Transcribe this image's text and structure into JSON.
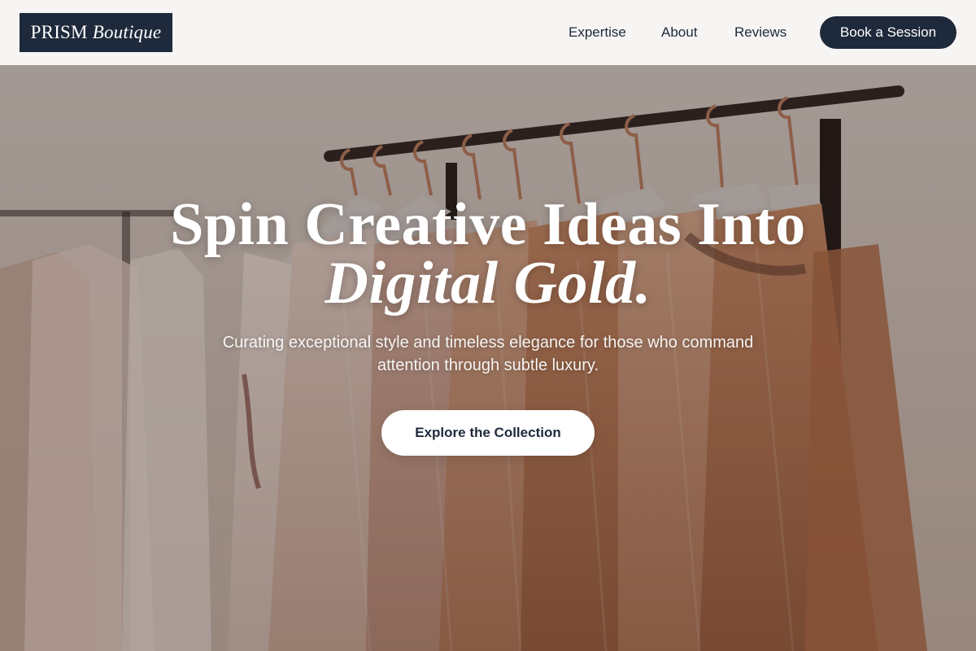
{
  "header": {
    "logo": {
      "main": "PRISM",
      "italic": "Boutique"
    },
    "nav": [
      {
        "label": "Expertise"
      },
      {
        "label": "About"
      },
      {
        "label": "Reviews"
      }
    ],
    "cta_label": "Book a Session"
  },
  "hero": {
    "title_line1": "Spin Creative Ideas Into",
    "title_line2": "Digital Gold.",
    "subtitle": "Curating exceptional style and timeless elegance for those who command attention through subtle luxury.",
    "cta_label": "Explore the Collection"
  },
  "colors": {
    "brand_navy": "#1e293b",
    "header_bg": "#f6f5f3",
    "hero_text": "#ffffff"
  }
}
